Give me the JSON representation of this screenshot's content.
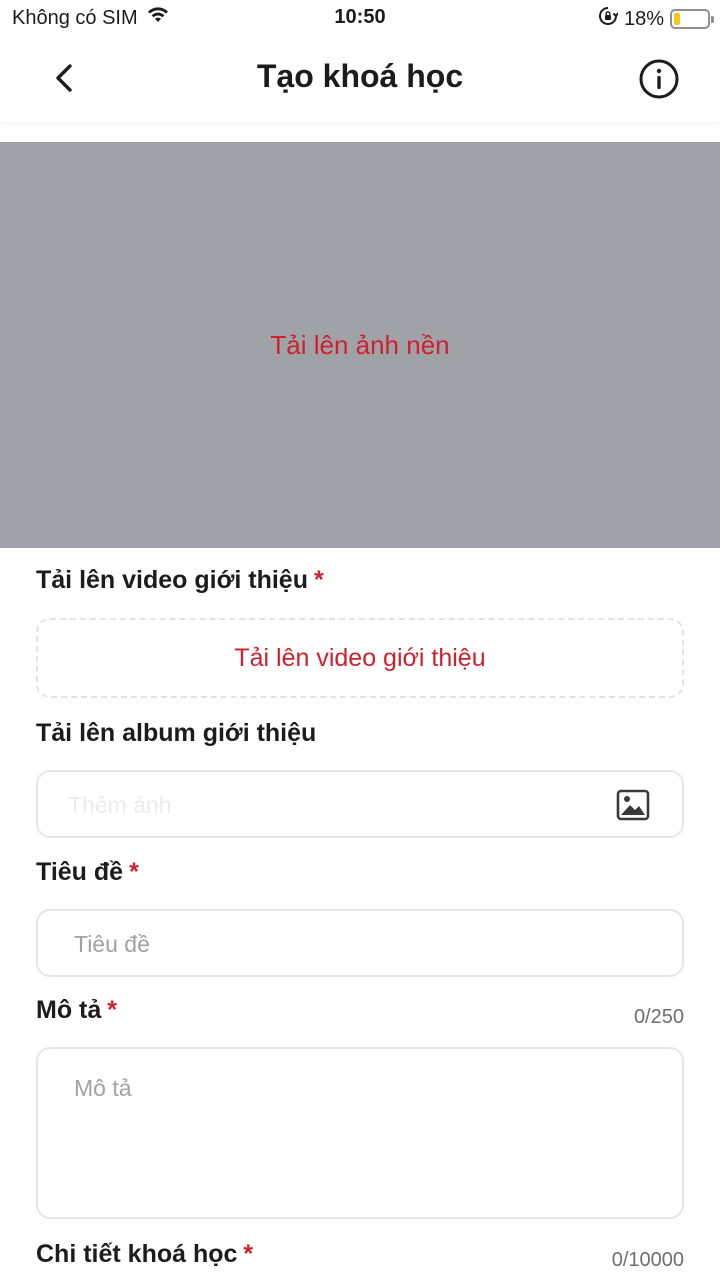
{
  "status_bar": {
    "carrier": "Không có SIM",
    "time": "10:50",
    "battery_percent": "18%",
    "battery_level": 0.18,
    "icons": [
      "wifi-icon",
      "orientation-lock-icon",
      "battery-icon"
    ]
  },
  "header": {
    "title": "Tạo khoá học",
    "icons": [
      "back-chevron-icon",
      "info-icon"
    ]
  },
  "cover": {
    "upload_label": "Tải lên ảnh nền",
    "background_color": "#9fa2a6"
  },
  "form": {
    "intro_video": {
      "label": "Tải lên video giới thiệu",
      "required_mark": "*",
      "button_label": "Tải lên video giới thiệu"
    },
    "album": {
      "label": "Tải lên album giới thiệu",
      "placeholder": "Thêm ảnh",
      "icon": "image-icon"
    },
    "title": {
      "label": "Tiêu đề",
      "required_mark": "*",
      "placeholder": "Tiêu đề"
    },
    "description": {
      "label": "Mô tả",
      "required_mark": "*",
      "placeholder": "Mô tả",
      "counter": "0/250"
    },
    "details": {
      "label": "Chi tiết khoá học",
      "required_mark": "*",
      "counter": "0/10000"
    }
  },
  "colors": {
    "accent_red": "#d0202e",
    "text_primary": "#1c1c1e",
    "border": "#e6e6e9"
  }
}
